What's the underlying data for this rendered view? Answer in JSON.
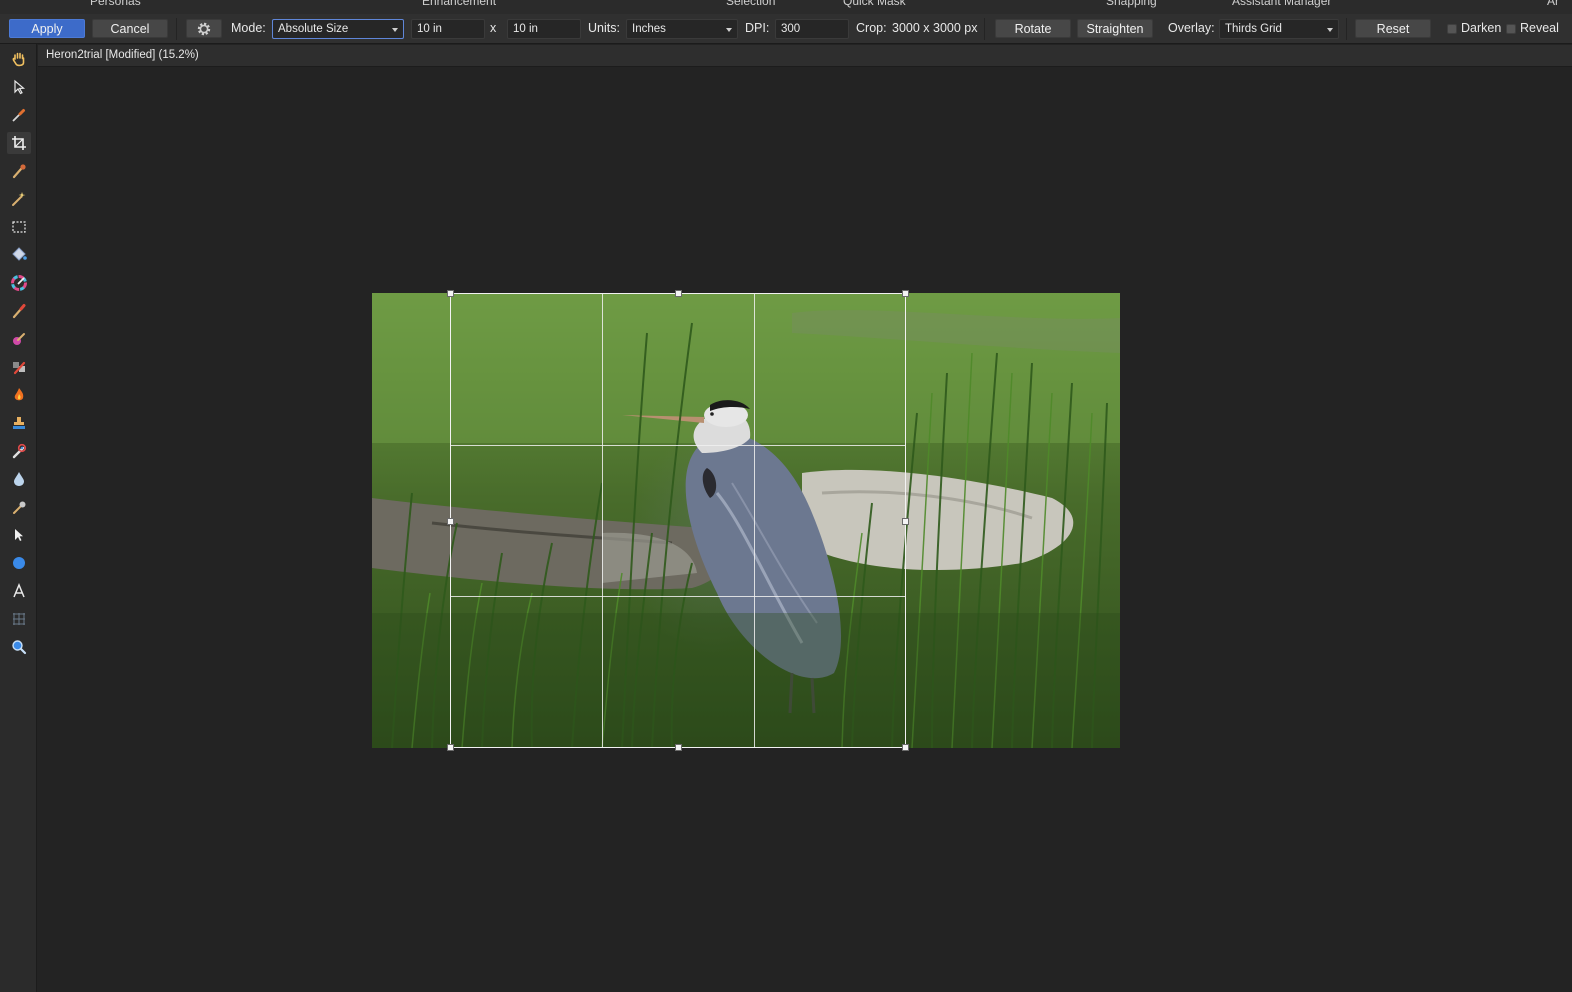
{
  "studio": {
    "items": [
      "Personas",
      "Enhancement",
      "Selection",
      "Quick Mask",
      "Snapping",
      "Assistant Manager",
      "Ar"
    ]
  },
  "toolbar": {
    "apply_label": "Apply",
    "cancel_label": "Cancel",
    "mode_label": "Mode:",
    "mode_value": "Absolute Size",
    "width_value": "10 in",
    "times_label": "x",
    "height_value": "10 in",
    "units_label": "Units:",
    "units_value": "Inches",
    "dpi_label": "DPI:",
    "dpi_value": "300",
    "crop_label": "Crop:",
    "crop_value": "3000 x 3000 px",
    "rotate_label": "Rotate",
    "straighten_label": "Straighten",
    "overlay_label": "Overlay:",
    "overlay_value": "Thirds Grid",
    "reset_label": "Reset",
    "darken_label": "Darken",
    "reveal_label": "Reveal"
  },
  "document": {
    "tab_title": "Heron2trial [Modified] (15.2%)"
  },
  "tools": [
    {
      "name": "view-tool",
      "icon": "hand-icon"
    },
    {
      "name": "move-tool",
      "icon": "pointer-icon"
    },
    {
      "name": "color-picker-tool",
      "icon": "eyedropper-icon"
    },
    {
      "name": "crop-tool",
      "icon": "crop-icon"
    },
    {
      "name": "selection-brush-tool",
      "icon": "selection-brush-icon"
    },
    {
      "name": "flood-select-tool",
      "icon": "magic-wand-icon"
    },
    {
      "name": "marquee-tool",
      "icon": "marquee-icon"
    },
    {
      "name": "flood-fill-tool",
      "icon": "paint-bucket-icon"
    },
    {
      "name": "gradient-tool",
      "icon": "color-wheel-icon"
    },
    {
      "name": "paint-brush-tool",
      "icon": "paintbrush-icon"
    },
    {
      "name": "color-replacement-tool",
      "icon": "color-brush-icon"
    },
    {
      "name": "erase-brush-tool",
      "icon": "eraser-icon"
    },
    {
      "name": "dodge-burn-tool",
      "icon": "flame-icon"
    },
    {
      "name": "clone-tool",
      "icon": "stamp-icon"
    },
    {
      "name": "healing-tool",
      "icon": "bandage-icon"
    },
    {
      "name": "blur-tool",
      "icon": "droplet-icon"
    },
    {
      "name": "smudge-tool",
      "icon": "smudge-icon"
    },
    {
      "name": "node-tool",
      "icon": "node-pointer-icon"
    },
    {
      "name": "shape-tool",
      "icon": "ellipse-icon"
    },
    {
      "name": "text-tool",
      "icon": "text-icon"
    },
    {
      "name": "mesh-warp-tool",
      "icon": "mesh-icon"
    },
    {
      "name": "zoom-tool",
      "icon": "magnifier-icon"
    }
  ],
  "colors": {
    "accent": "#3d6bc9",
    "panel": "#303030",
    "canvas": "#232323"
  }
}
